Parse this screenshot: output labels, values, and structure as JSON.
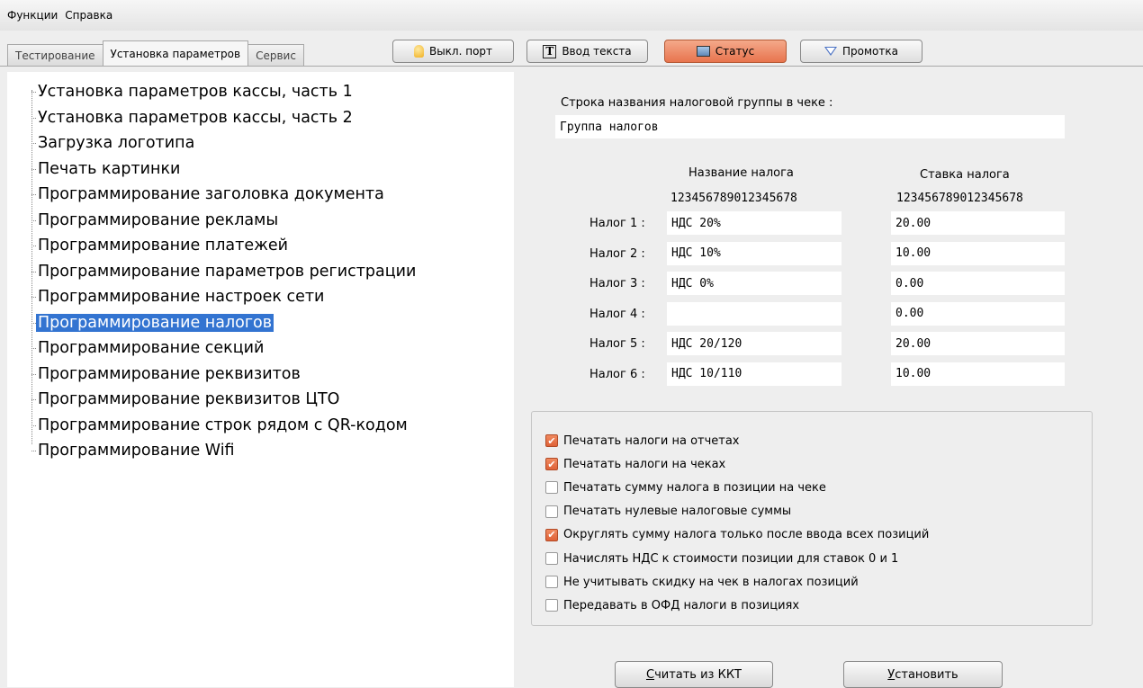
{
  "menu": [
    "Функции",
    "Справка"
  ],
  "tabs": [
    "Тестирование",
    "Установка параметров",
    "Сервис"
  ],
  "toolbar": {
    "port": "Выкл. порт",
    "text_input": "Ввод текста",
    "status": "Статус",
    "scroll": "Промотка"
  },
  "tree": [
    "Установка параметров кассы, часть 1",
    "Установка параметров кассы, часть 2",
    "Загрузка логотипа",
    "Печать картинки",
    "Программирование заголовка документа",
    "Программирование рекламы",
    "Программирование платежей",
    "Программирование параметров регистрации",
    "Программирование настроек сети",
    "Программирование налогов",
    "Программирование секций",
    "Программирование реквизитов",
    "Программирование реквизитов ЦТО",
    "Программирование строк рядом с QR-кодом",
    "Программирование Wifi"
  ],
  "selected_index": 9,
  "form": {
    "group_label": "Строка названия налоговой группы  в чеке :",
    "group_value": "Группа налогов",
    "col_name": "Название налога",
    "col_rate": "Ставка налога",
    "ruler_name": "123456789012345678",
    "ruler_rate": "123456789012345678",
    "taxes": [
      {
        "label": "Налог 1 :",
        "name": "НДС 20%",
        "rate": "20.00"
      },
      {
        "label": "Налог 2 :",
        "name": "НДС 10%",
        "rate": "10.00"
      },
      {
        "label": "Налог 3 :",
        "name": "НДС 0%",
        "rate": "0.00"
      },
      {
        "label": "Налог 4 :",
        "name": "",
        "rate": "0.00"
      },
      {
        "label": "Налог 5 :",
        "name": "НДС 20/120",
        "rate": "20.00"
      },
      {
        "label": "Налог 6 :",
        "name": "НДС 10/110",
        "rate": "10.00"
      }
    ]
  },
  "options": [
    {
      "label": "Печатать налоги на отчетах",
      "checked": true
    },
    {
      "label": "Печатать налоги на чеках",
      "checked": true
    },
    {
      "label": "Печатать сумму налога в позиции на чеке",
      "checked": false
    },
    {
      "label": "Печатать нулевые налоговые суммы",
      "checked": false
    },
    {
      "label": "Округлять сумму налога только после ввода всех позиций",
      "checked": true
    },
    {
      "label": "Начислять НДС к стоимости позиции для ставок 0 и 1",
      "checked": false
    },
    {
      "label": "Не учитывать скидку на чек в налогах позиций",
      "checked": false
    },
    {
      "label": "Передавать в ОФД налоги в позициях",
      "checked": false
    }
  ],
  "buttons": {
    "read": "Считать из ККТ",
    "set": "Установить"
  }
}
